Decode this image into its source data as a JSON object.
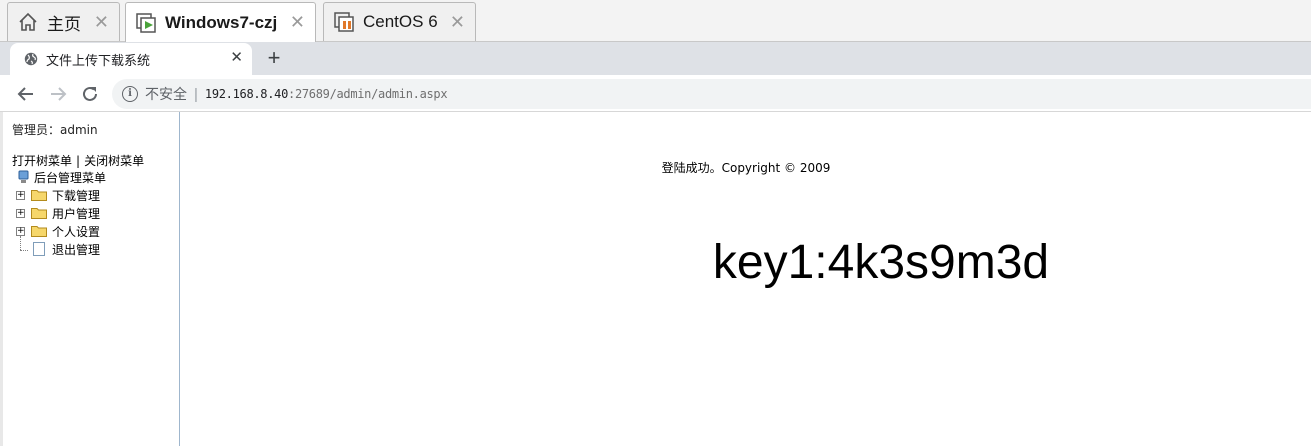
{
  "vm_tabs": [
    {
      "label": "主页",
      "icon": "home-icon",
      "active": false
    },
    {
      "label": "Windows7-czj",
      "icon": "vm-running-icon",
      "active": true
    },
    {
      "label": "CentOS 6",
      "icon": "vm-suspended-icon",
      "active": false
    }
  ],
  "browser": {
    "tab_title": "文件上传下载系统",
    "tab_favicon": "globe-icon",
    "new_tab": "+",
    "security_label": "不安全",
    "url_host": "192.168.8.40",
    "url_rest": ":27689/admin/admin.aspx"
  },
  "sidebar": {
    "admin_label": "管理员：admin",
    "open_tree": "打开树菜单",
    "separator": "|",
    "close_tree": "关闭树菜单",
    "root": "后台管理菜单",
    "items": [
      {
        "label": "下载管理",
        "type": "folder"
      },
      {
        "label": "用户管理",
        "type": "folder"
      },
      {
        "label": "个人设置",
        "type": "folder"
      },
      {
        "label": "退出管理",
        "type": "document"
      }
    ]
  },
  "main": {
    "status": "登陆成功。Copyright © 2009",
    "key": "key1:4k3s9m3d"
  },
  "colors": {
    "vm_strip_bg": "#f3f3f3",
    "browser_strip_bg": "#dee1e6",
    "omnibox_bg": "#f1f3f4",
    "frame_border": "#9fb6cd"
  }
}
